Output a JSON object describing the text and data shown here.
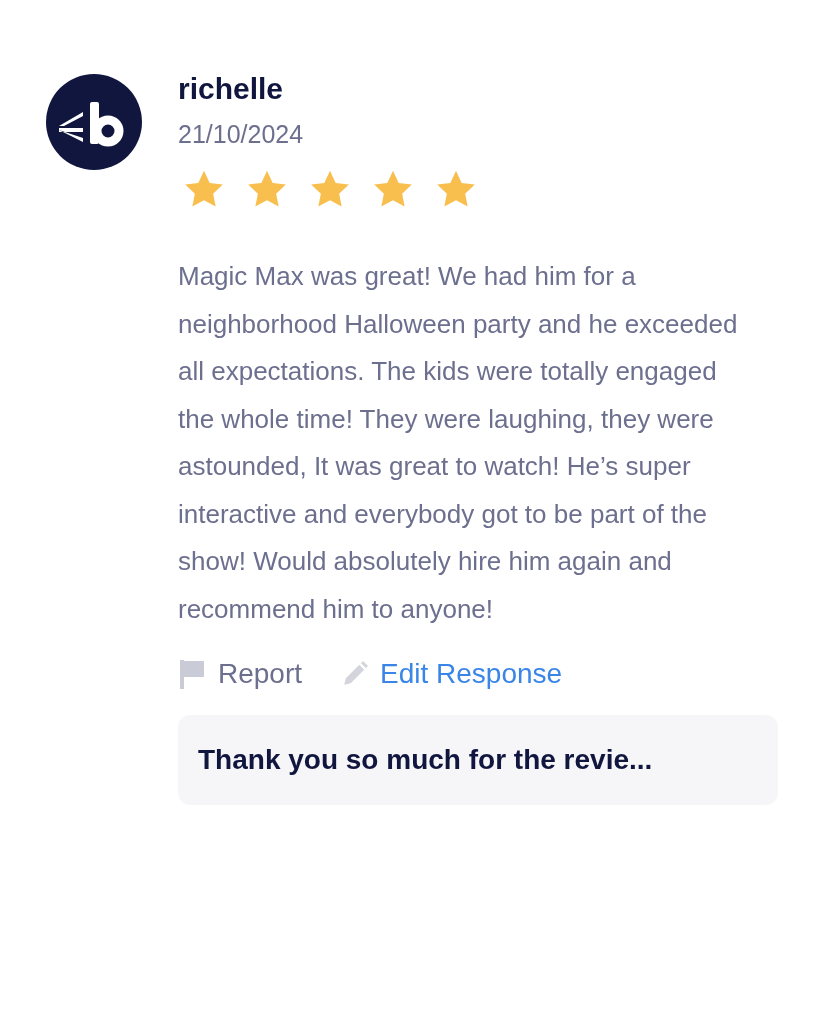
{
  "review": {
    "author": "richelle",
    "date": "21/10/2024",
    "stars": 5,
    "text": "Magic Max was great! We had him for a neighborhood Halloween party and he exceeded all expectations. The kids were totally engaged the whole time! They were laughing, they were astounded, It was great to watch! He’s super interactive and everybody got to be part of the show! Would absolutely hire him again and recommend him to anyone!"
  },
  "actions": [
    {
      "kind": "report",
      "label": "Report"
    },
    {
      "kind": "edit",
      "label": "Edit Response"
    }
  ],
  "response": {
    "text": "Thank you so much for the revie..."
  }
}
